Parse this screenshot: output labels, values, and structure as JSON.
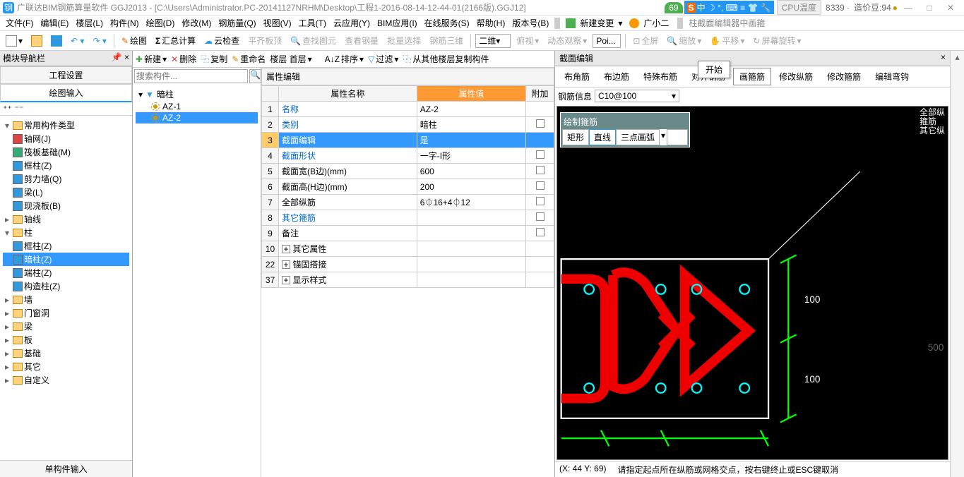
{
  "title": "广联达BIM钢筋算量软件 GGJ2013 - [C:\\Users\\Administrator.PC-20141127NRHM\\Desktop\\工程1-2016-08-14-12-44-01(2166版).GGJ12]",
  "badge69": "69",
  "ime": "S 中",
  "cpu": "CPU温度",
  "extra1": "8339 ·",
  "extra2": "造价豆:94",
  "menus": [
    "文件(F)",
    "编辑(E)",
    "楼层(L)",
    "构件(N)",
    "绘图(D)",
    "修改(M)",
    "钢筋量(Q)",
    "视图(V)",
    "工具(T)",
    "云应用(Y)",
    "BIM应用(I)",
    "在线服务(S)",
    "帮助(H)",
    "版本号(B)"
  ],
  "newChange": "新建变更",
  "user": "广小二",
  "rightMenu": "柱截面编辑器中画箍",
  "tb2": {
    "draw": "绘图",
    "sum": "汇总计算",
    "cloud": "云检查",
    "flat": "平齐板顶",
    "find": "查找图元",
    "steel": "查看钢量",
    "batch": "批量选择",
    "rebar3d": "钢筋三维",
    "dim2": "二维",
    "bird": "俯视",
    "dyn": "动态观察",
    "poi": "Poi...",
    "full": "全屏",
    "zoom": "缩放",
    "pan": "平移",
    "rotate": "屏幕旋转"
  },
  "nav": {
    "title": "模块导航栏",
    "tab1": "工程设置",
    "tab2": "绘图输入",
    "items": [
      {
        "t": "常用构件类型",
        "exp": "▾",
        "lv": 0,
        "fold": true
      },
      {
        "t": "轴网(J)",
        "lv": 1,
        "ic": "#d44"
      },
      {
        "t": "筏板基础(M)",
        "lv": 1,
        "ic": "#3a7"
      },
      {
        "t": "框柱(Z)",
        "lv": 1,
        "ic": "#39d"
      },
      {
        "t": "剪力墙(Q)",
        "lv": 1,
        "ic": "#39d"
      },
      {
        "t": "梁(L)",
        "lv": 1,
        "ic": "#39d"
      },
      {
        "t": "现浇板(B)",
        "lv": 1,
        "ic": "#39d"
      },
      {
        "t": "轴线",
        "exp": "▸",
        "lv": 0,
        "fold": true
      },
      {
        "t": "柱",
        "exp": "▾",
        "lv": 0,
        "fold": true
      },
      {
        "t": "框柱(Z)",
        "lv": 1,
        "ic": "#39d"
      },
      {
        "t": "暗柱(Z)",
        "lv": 1,
        "ic": "#39d",
        "sel": true
      },
      {
        "t": "端柱(Z)",
        "lv": 1,
        "ic": "#39d"
      },
      {
        "t": "构造柱(Z)",
        "lv": 1,
        "ic": "#39d"
      },
      {
        "t": "墙",
        "exp": "▸",
        "lv": 0,
        "fold": true
      },
      {
        "t": "门窗洞",
        "exp": "▸",
        "lv": 0,
        "fold": true
      },
      {
        "t": "梁",
        "exp": "▸",
        "lv": 0,
        "fold": true
      },
      {
        "t": "板",
        "exp": "▸",
        "lv": 0,
        "fold": true
      },
      {
        "t": "基础",
        "exp": "▸",
        "lv": 0,
        "fold": true
      },
      {
        "t": "其它",
        "exp": "▸",
        "lv": 0,
        "fold": true
      },
      {
        "t": "自定义",
        "exp": "▸",
        "lv": 0,
        "fold": true
      }
    ],
    "footer": "单构件输入"
  },
  "mid": {
    "toolbar": [
      "新建",
      "删除",
      "复制",
      "重命名",
      "楼层 首层",
      "排序",
      "过滤",
      "从其他楼层复制构件"
    ],
    "searchPlaceholder": "搜索构件...",
    "compTree": [
      {
        "t": "暗柱",
        "lv": 0
      },
      {
        "t": "AZ-1",
        "lv": 1
      },
      {
        "t": "AZ-2",
        "lv": 1,
        "sel": true
      }
    ],
    "propHeader": "属性编辑",
    "cols": [
      "属性名称",
      "属性值",
      "附加"
    ],
    "rows": [
      {
        "n": "1",
        "name": "名称",
        "val": "AZ-2",
        "link": true
      },
      {
        "n": "2",
        "name": "类别",
        "val": "暗柱",
        "link": true,
        "chk": true
      },
      {
        "n": "3",
        "name": "截面编辑",
        "val": "是",
        "link": true,
        "sel": true
      },
      {
        "n": "4",
        "name": "截面形状",
        "val": "一字-I形",
        "link": true,
        "chk": true
      },
      {
        "n": "5",
        "name": "截面宽(B边)(mm)",
        "val": "600",
        "chk": true
      },
      {
        "n": "6",
        "name": "截面高(H边)(mm)",
        "val": "200",
        "chk": true
      },
      {
        "n": "7",
        "name": "全部纵筋",
        "val": "6⏀16+4⏀12",
        "chk": true
      },
      {
        "n": "8",
        "name": "其它箍筋",
        "val": "",
        "link": true,
        "chk": true
      },
      {
        "n": "9",
        "name": "备注",
        "val": "",
        "chk": true
      },
      {
        "n": "10",
        "name": "其它属性",
        "exp": "+"
      },
      {
        "n": "22",
        "name": "锚固搭接",
        "exp": "+"
      },
      {
        "n": "37",
        "name": "显示样式",
        "exp": "+"
      }
    ]
  },
  "rp": {
    "title": "截面编辑",
    "tabs": [
      "布角筋",
      "布边筋",
      "特殊布筋",
      "对齐钢筋",
      "画箍筋",
      "修改纵筋",
      "修改箍筋",
      "编辑弯钩"
    ],
    "activeTab": 4,
    "info": "钢筋信息",
    "infoVal": "C10@100",
    "ctTitle": "绘制箍筋",
    "ctBtns": [
      "矩形",
      "直线",
      "三点画弧"
    ],
    "corner": [
      "全部纵",
      "箍筋",
      "其它纵"
    ],
    "dim1": "100",
    "dim2": "100",
    "dim500": "500",
    "status1": "(X: 44 Y: 69)",
    "status2": "请指定起点所在纵筋或网格交点，按右键终止或ESC键取消"
  },
  "tooltip": "开始"
}
